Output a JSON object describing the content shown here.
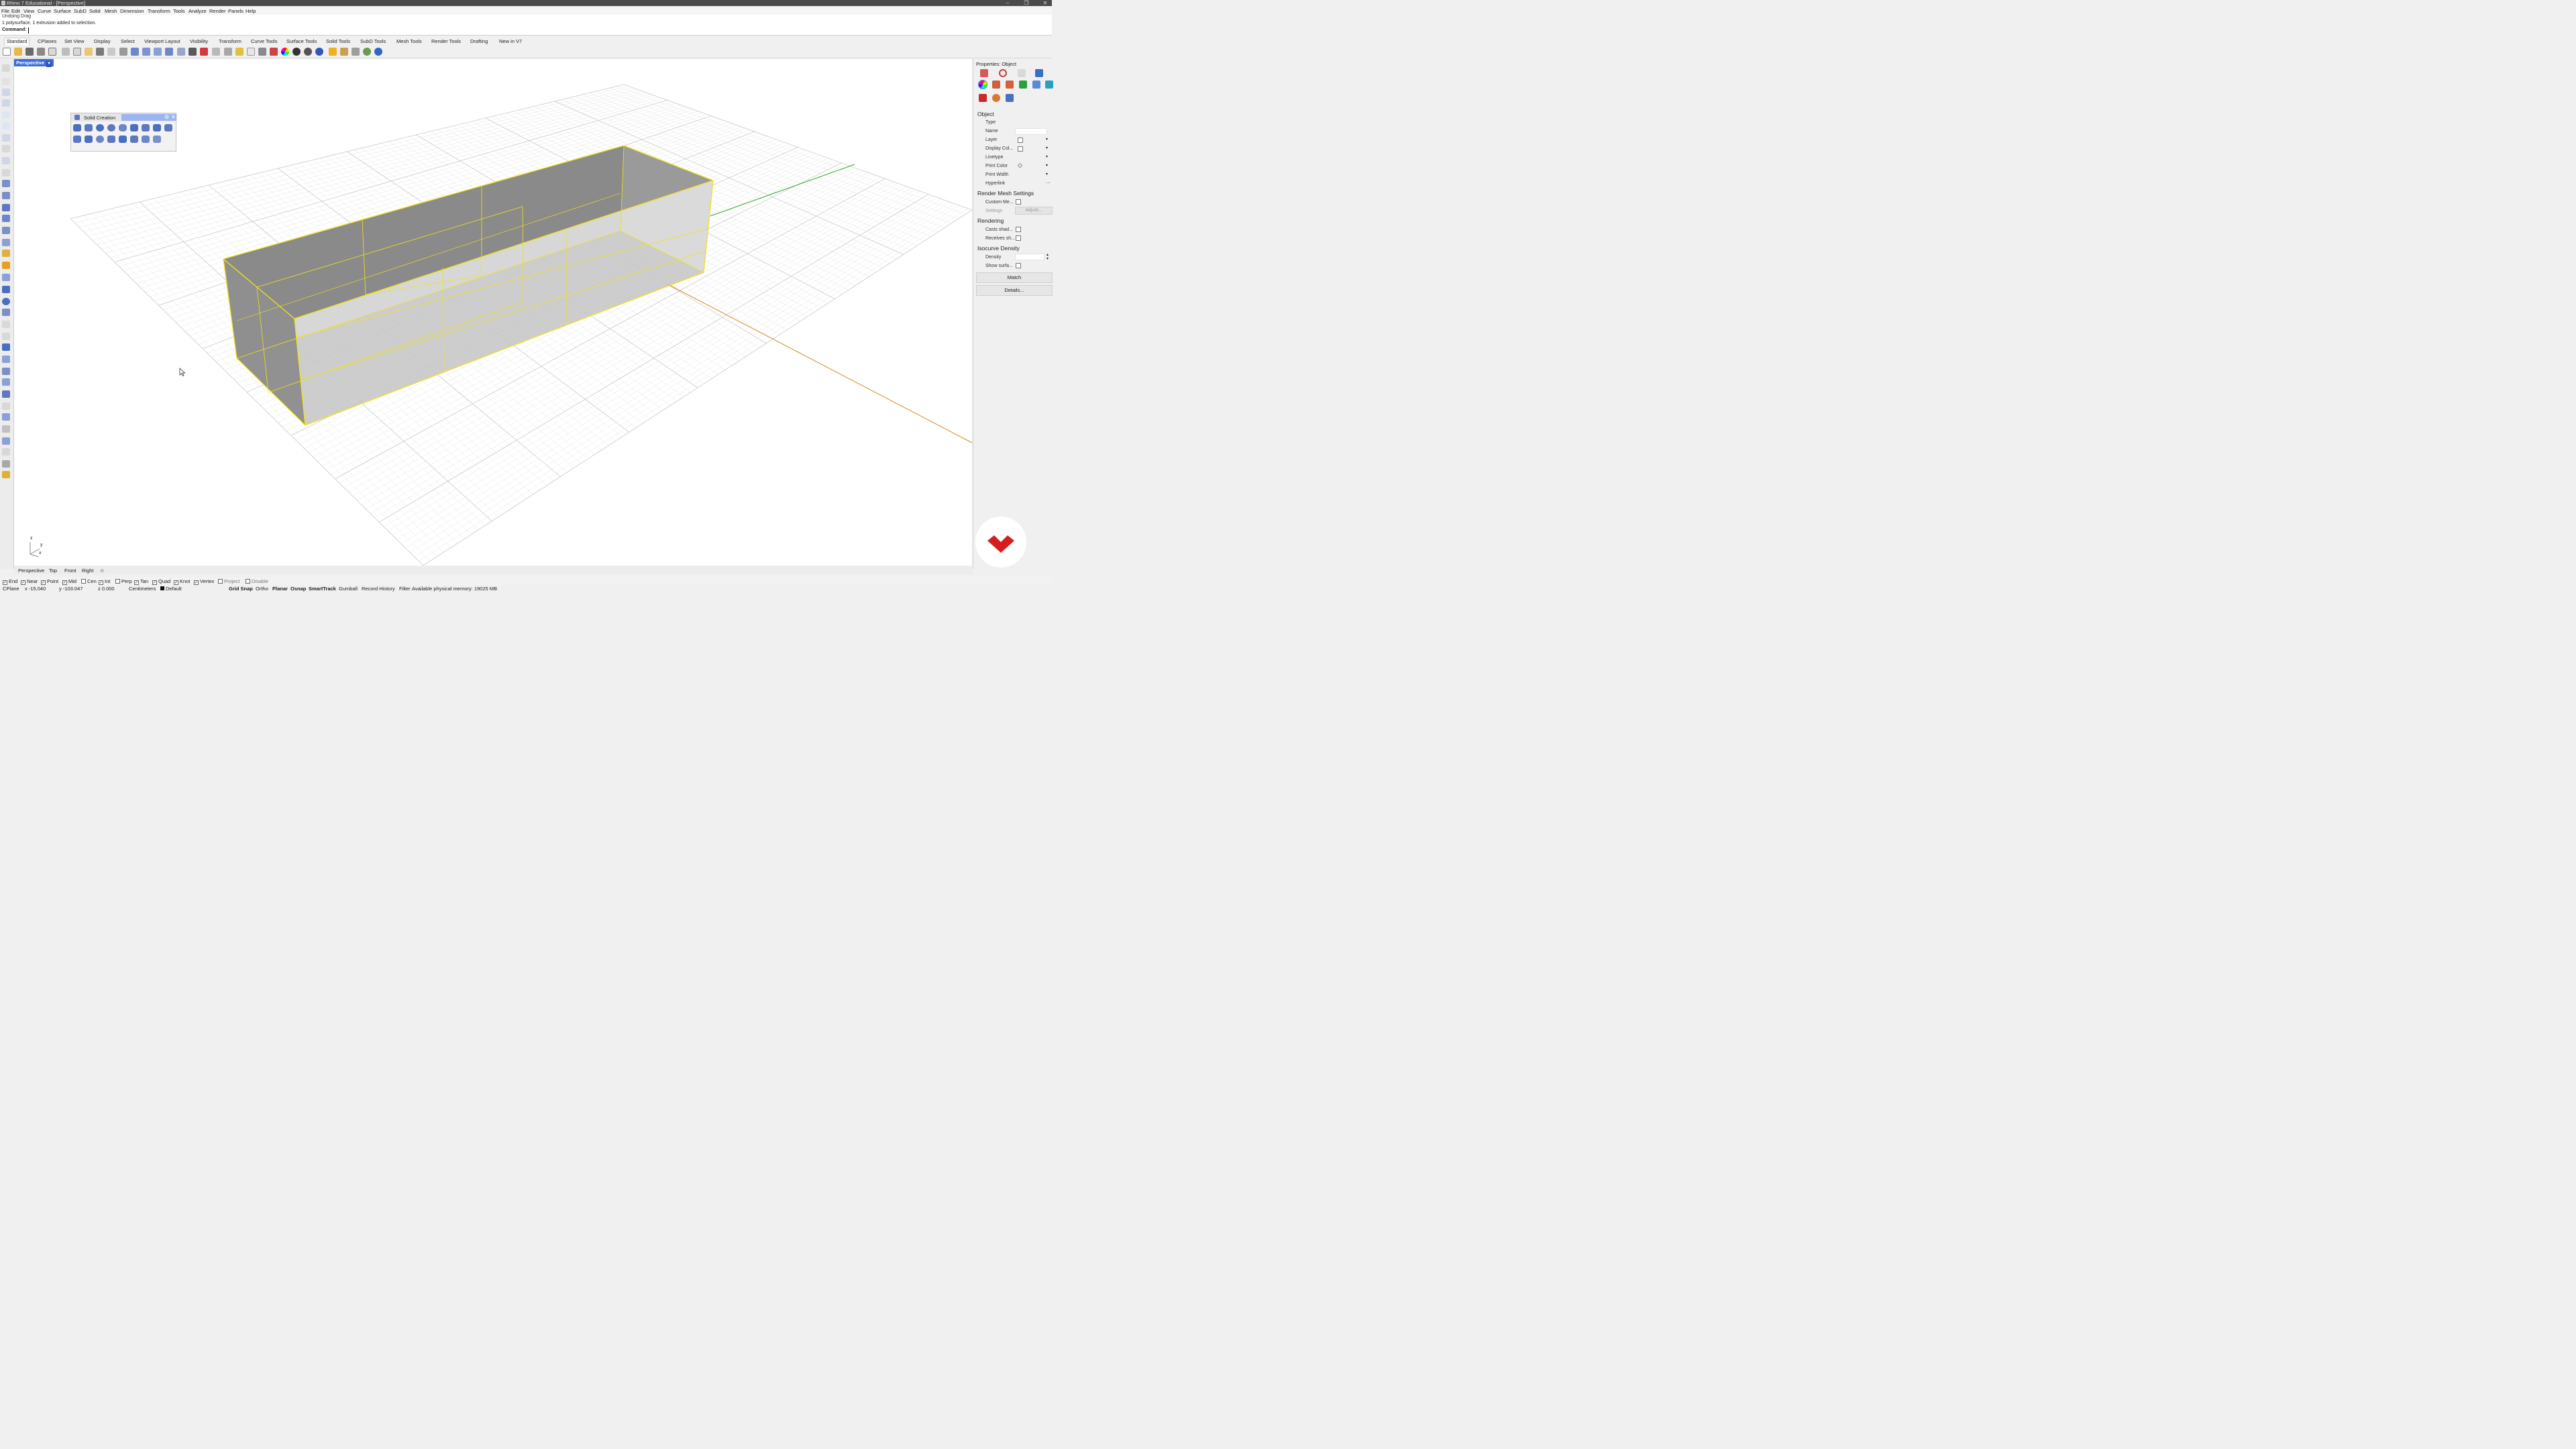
{
  "window": {
    "title": "Rhino 7 Educational - [Perspective]"
  },
  "menu": [
    "File",
    "Edit",
    "View",
    "Curve",
    "Surface",
    "SubD",
    "Solid",
    "Mesh",
    "Dimension",
    "Transform",
    "Tools",
    "Analyze",
    "Render",
    "Panels",
    "Help"
  ],
  "command_history": [
    "Undoing Drag",
    "1 polysurface, 1 extrusion added to selection."
  ],
  "command_prompt": "Command:",
  "toolbar_tabs": [
    "Standard",
    "CPlanes",
    "Set View",
    "Display",
    "Select",
    "Viewport Layout",
    "Visibility",
    "Transform",
    "Curve Tools",
    "Surface Tools",
    "Solid Tools",
    "SubD Tools",
    "Mesh Tools",
    "Render Tools",
    "Drafting",
    "New in V7"
  ],
  "viewport": {
    "name": "Perspective",
    "dropdown_icon": "chevron-down-icon"
  },
  "palette": {
    "title": "Solid Creation"
  },
  "properties": {
    "title": "Properties: Object",
    "sections": {
      "object": "Object",
      "render_mesh": "Render Mesh Settings",
      "rendering": "Rendering",
      "isocurve": "Isocurve Density"
    },
    "fields": {
      "type": "Type",
      "name": "Name",
      "layer": "Layer",
      "display_color": "Display Col...",
      "linetype": "Linetype",
      "print_color": "Print Color",
      "print_width": "Print Width",
      "hyperlink": "Hyperlink",
      "custom_mesh": "Custom Me...",
      "settings": "Settings",
      "adjust": "Adjust...",
      "casts_shadows": "Casts shad...",
      "receives_shadows": "Receives sh...",
      "density": "Density",
      "show_surface": "Show surfa..."
    },
    "buttons": {
      "match": "Match",
      "details": "Details..."
    }
  },
  "view_tabs": [
    "Perspective",
    "Top",
    "Front",
    "Right"
  ],
  "osnaps": [
    {
      "label": "End",
      "checked": true
    },
    {
      "label": "Near",
      "checked": true
    },
    {
      "label": "Point",
      "checked": true
    },
    {
      "label": "Mid",
      "checked": true
    },
    {
      "label": "Cen",
      "checked": false
    },
    {
      "label": "Int",
      "checked": true
    },
    {
      "label": "Perp",
      "checked": false
    },
    {
      "label": "Tan",
      "checked": true
    },
    {
      "label": "Quad",
      "checked": true
    },
    {
      "label": "Knot",
      "checked": true
    },
    {
      "label": "Vertex",
      "checked": true
    },
    {
      "label": "Project",
      "checked": false
    },
    {
      "label": "Disable",
      "checked": false
    }
  ],
  "status": {
    "cplane": "CPlane",
    "x": "x -15.040",
    "y": "y -103.047",
    "z": "z 0.000",
    "units": "Centimeters",
    "layer": "Default",
    "grid_snap": "Grid Snap",
    "ortho": "Ortho",
    "planar": "Planar",
    "osnap": "Osnap",
    "smarttrack": "SmartTrack",
    "gumball": "Gumball",
    "record_history": "Record History",
    "filter": "Filter",
    "memory": "Available physical memory: 19025 MB"
  },
  "axis_labels": {
    "z": "z",
    "y": "y",
    "x": "x"
  },
  "colors": {
    "selection": "#f2e21a",
    "y_axis": "#3aa63a",
    "x_axis": "#d48a20",
    "viewport_tab": "#3e6bd6",
    "logo": "#d61c1c"
  }
}
